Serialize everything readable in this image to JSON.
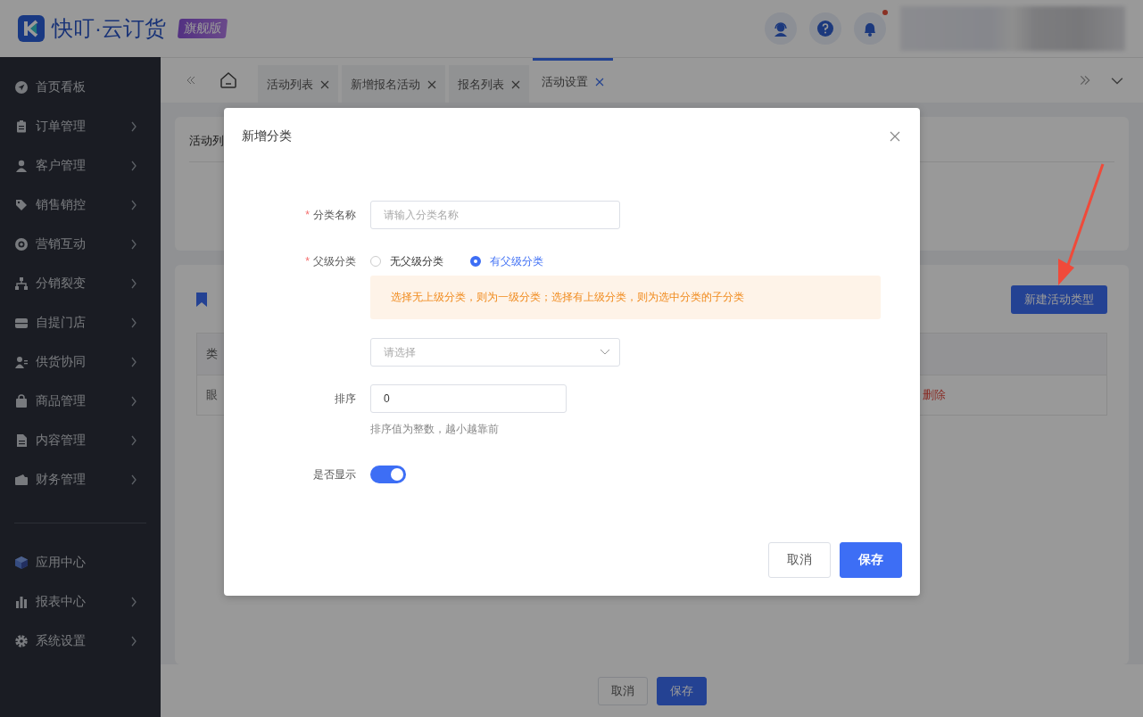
{
  "header": {
    "logo_text": "快叮·云订货",
    "edition_badge": "旗舰版",
    "bell_unread": true
  },
  "sidebar": {
    "items": [
      {
        "label": "首页看板",
        "expandable": false
      },
      {
        "label": "订单管理",
        "expandable": true
      },
      {
        "label": "客户管理",
        "expandable": true
      },
      {
        "label": "销售销控",
        "expandable": true
      },
      {
        "label": "营销互动",
        "expandable": true
      },
      {
        "label": "分销裂变",
        "expandable": true
      },
      {
        "label": "自提门店",
        "expandable": true
      },
      {
        "label": "供货协同",
        "expandable": true
      },
      {
        "label": "商品管理",
        "expandable": true
      },
      {
        "label": "内容管理",
        "expandable": true
      },
      {
        "label": "财务管理",
        "expandable": true
      }
    ],
    "bottom_items": [
      {
        "label": "应用中心",
        "expandable": false
      },
      {
        "label": "报表中心",
        "expandable": true
      },
      {
        "label": "系统设置",
        "expandable": true
      }
    ]
  },
  "tabs": [
    {
      "label": "活动列表",
      "selected": false
    },
    {
      "label": "新增报名活动",
      "selected": false
    },
    {
      "label": "报名列表",
      "selected": false
    },
    {
      "label": "活动设置",
      "selected": true
    }
  ],
  "background": {
    "card_tab": "活动列",
    "new_button": "新建活动类型",
    "table_header": "类",
    "table_cell": "眼",
    "row_action": "删除"
  },
  "footer_buttons": [
    "取消",
    "保存"
  ],
  "dialog": {
    "title": "新增分类",
    "name": {
      "label": "分类名称",
      "required_mark": "*",
      "placeholder": "请输入分类名称"
    },
    "parent": {
      "label": "父级分类",
      "required_mark": "*",
      "options": [
        {
          "label": "无父级分类",
          "selected": false
        },
        {
          "label": "有父级分类",
          "selected": true
        }
      ],
      "notice": "选择无上级分类，则为一级分类；选择有上级分类，则为选中分类的子分类",
      "select_placeholder": "请选择"
    },
    "sort": {
      "label": "排序",
      "value": "0",
      "hint": "排序值为整数，越小越靠前"
    },
    "visible": {
      "label": "是否显示",
      "on": true
    },
    "buttons": [
      "取消",
      "保存"
    ]
  }
}
